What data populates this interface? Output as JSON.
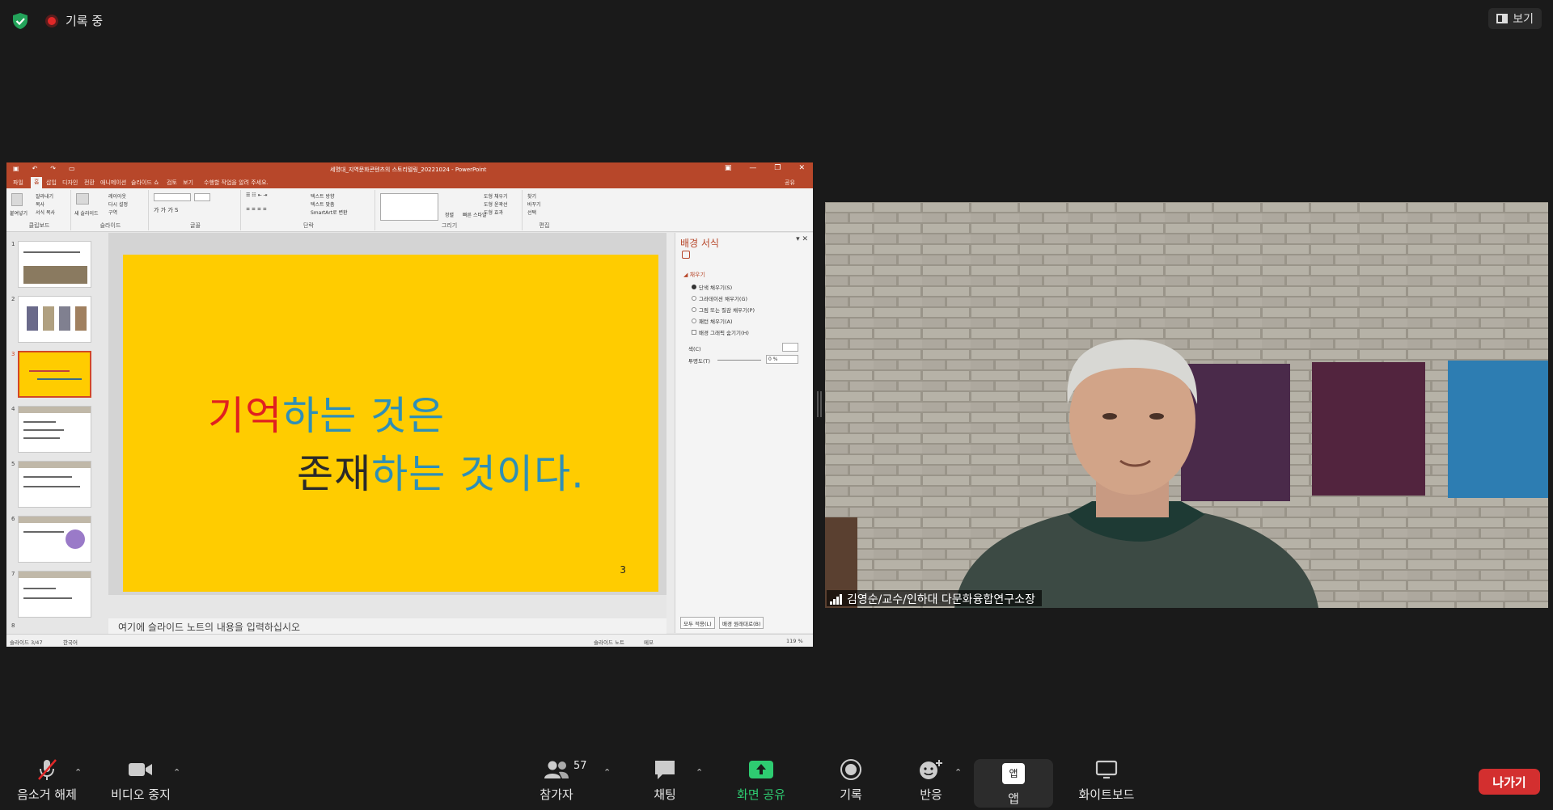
{
  "top_bar": {
    "recording_label": "기록 중",
    "view_label": "보기"
  },
  "ppt": {
    "window_title": "세명대_지역문화콘텐츠의 스토리텔링_20221024 - PowerPoint",
    "tabs": [
      "파일",
      "홈",
      "삽입",
      "디자인",
      "전환",
      "애니메이션",
      "슬라이드 쇼",
      "검토",
      "보기"
    ],
    "tell_me": "수행할 작업을 알려 주세요.",
    "share": "공유",
    "ribbon_groups": [
      "클립보드",
      "슬라이드",
      "글꼴",
      "단락",
      "그리기",
      "편집"
    ],
    "ribbon_items": {
      "paste": "붙여넣기",
      "cut": "잘라내기",
      "copy": "복사",
      "format_painter": "서식 복사",
      "new_slide": "새 슬라이드",
      "layout": "레이아웃",
      "reset": "다시 설정",
      "section": "구역",
      "text_direction": "텍스트 방향",
      "align_text": "텍스트 맞춤",
      "smartart": "SmartArt로 변환",
      "arrange": "정렬",
      "quick_styles": "빠른 스타일",
      "shape_fill": "도형 채우기",
      "shape_outline": "도형 윤곽선",
      "shape_effects": "도형 효과",
      "find": "찾기",
      "replace": "바꾸기",
      "select": "선택"
    },
    "thumbnail_numbers": [
      "1",
      "2",
      "3",
      "4",
      "5",
      "6",
      "7",
      "8"
    ],
    "selected_slide": 3,
    "slide": {
      "line1_red": "기억",
      "line1_blue": "하는 것은",
      "line2_dark": "존재",
      "line2_blue": "하는 것이다.",
      "page_number": "3"
    },
    "notes_placeholder": "여기에 슬라이드 노트의 내용을 입력하십시오",
    "format_pane": {
      "title": "배경 서식",
      "section": "채우기",
      "options": [
        "단색 채우기(S)",
        "그라데이션 채우기(G)",
        "그림 또는 질감 채우기(P)",
        "패턴 채우기(A)"
      ],
      "hide_graphics": "배경 그래픽 숨기기(H)",
      "color_label": "색(C)",
      "transparency_label": "투명도(T)",
      "transparency_value": "0 %",
      "apply_all": "모두 적용(L)",
      "reset_bg": "배경 원래대로(B)"
    },
    "status": {
      "slide_info": "슬라이드 3/47",
      "language": "한국어",
      "notes": "슬라이드 노트",
      "comments": "메모",
      "zoom": "119 %"
    }
  },
  "video": {
    "participant_name": "김영순/교수/인하대 다문화융합연구소장"
  },
  "toolbar": {
    "unmute": "음소거 해제",
    "stop_video": "비디오 중지",
    "participants": "참가자",
    "participant_count": "57",
    "chat": "채팅",
    "share_screen": "화면 공유",
    "record": "기록",
    "reactions": "반응",
    "apps": "앱",
    "apps_icon_text": "앱",
    "whiteboard": "화이트보드",
    "leave": "나가기"
  },
  "colors": {
    "zoom_bg": "#1a1a1a",
    "ppt_accent": "#b7472a",
    "slide_bg": "#ffcc00",
    "leave_red": "#d32f2f",
    "share_green": "#2ecc71"
  }
}
